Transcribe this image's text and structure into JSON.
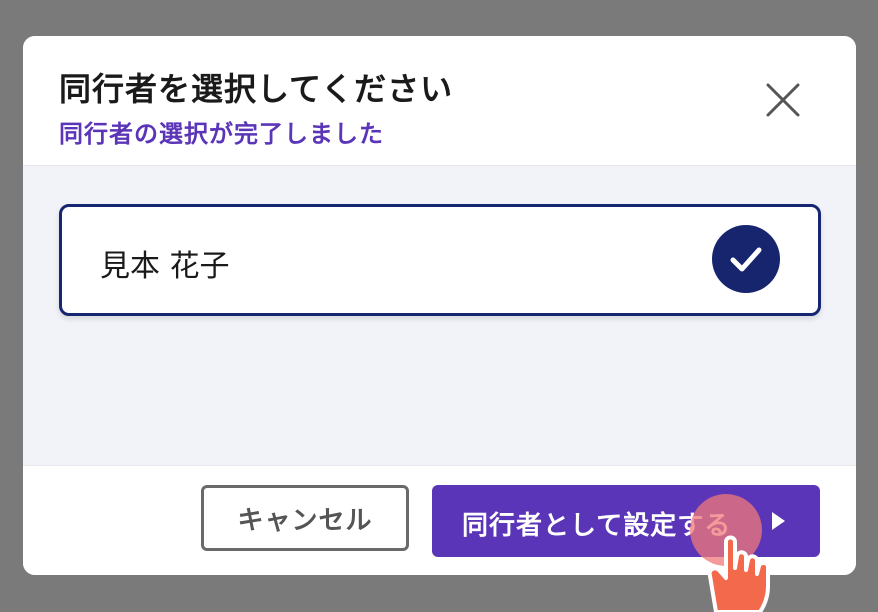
{
  "dialog": {
    "title": "同行者を選択してください",
    "subtitle": "同行者の選択が完了しました",
    "close_icon": "close-icon"
  },
  "companions": [
    {
      "name": "見本 花子",
      "selected": true,
      "check_icon": "checkmark-icon"
    }
  ],
  "footer": {
    "cancel_label": "キャンセル",
    "confirm_label": "同行者として設定する",
    "confirm_icon": "play-icon"
  },
  "colors": {
    "overlay": "#7a7a7a",
    "accent_purple": "#5b35b8",
    "navy": "#16256e",
    "body_bg": "#f2f3f8",
    "tap_highlight": "#f07878",
    "hand": "#f26a4b"
  }
}
